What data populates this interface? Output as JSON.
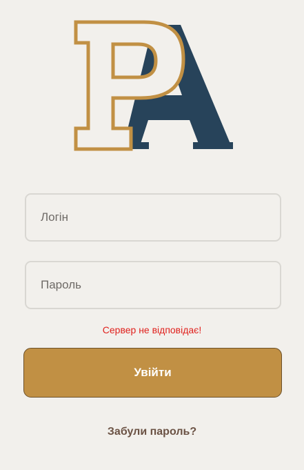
{
  "logo": {
    "icon": "pa-monogram-logo",
    "text": "PA",
    "colors": {
      "p_outline": "#c19044",
      "a_fill": "#27435a"
    }
  },
  "form": {
    "login_placeholder": "Логін",
    "password_placeholder": "Пароль",
    "error_message": "Сервер не відповідає!",
    "submit_label": "Увійти",
    "forgot_password_label": "Забули пароль?"
  },
  "colors": {
    "background": "#f2f0ec",
    "accent": "#c19044",
    "error": "#e0201c",
    "link": "#6b5244"
  }
}
